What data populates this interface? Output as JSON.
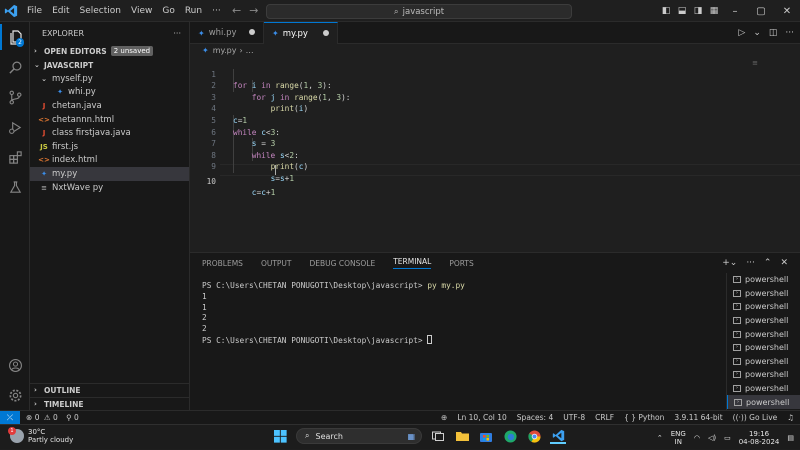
{
  "titlebar": {
    "menu": [
      "File",
      "Edit",
      "Selection",
      "View",
      "Go",
      "Run",
      "···"
    ],
    "search_text": "javascript"
  },
  "sidebar": {
    "title": "EXPLORER",
    "open_editors": "OPEN EDITORS",
    "unsaved_badge": "2 unsaved",
    "folder": "JAVASCRIPT",
    "items": [
      {
        "label": "myself.py",
        "icon": "folder-chevron",
        "indent": 1
      },
      {
        "label": "whi.py",
        "icon": "python-icon",
        "indent": 2
      },
      {
        "label": "chetan.java",
        "icon": "java-icon",
        "indent": 1
      },
      {
        "label": "chetannn.html",
        "icon": "html-icon",
        "indent": 1
      },
      {
        "label": "class firstjava.java",
        "icon": "java-icon",
        "indent": 1
      },
      {
        "label": "first.js",
        "icon": "js-icon",
        "indent": 1
      },
      {
        "label": "index.html",
        "icon": "html-icon",
        "indent": 1
      },
      {
        "label": "my.py",
        "icon": "python-icon",
        "indent": 1,
        "selected": true
      },
      {
        "label": "NxtWave py",
        "icon": "text-icon",
        "indent": 1
      }
    ],
    "outline": "OUTLINE",
    "timeline": "TIMELINE",
    "activity_badge": "2"
  },
  "editor": {
    "tabs": [
      {
        "label": "whi.py",
        "active": false,
        "dirty": true
      },
      {
        "label": "my.py",
        "active": true,
        "dirty": true
      }
    ],
    "breadcrumb": [
      "my.py",
      "…"
    ],
    "lines": [
      {
        "n": "1",
        "indent": 0
      },
      {
        "n": "2",
        "indent": 1
      },
      {
        "n": "3",
        "indent": 2
      },
      {
        "n": "4",
        "indent": 0
      },
      {
        "n": "5",
        "indent": 0
      },
      {
        "n": "6",
        "indent": 1
      },
      {
        "n": "7",
        "indent": 1
      },
      {
        "n": "8",
        "indent": 2
      },
      {
        "n": "9",
        "indent": 2
      },
      {
        "n": "10",
        "indent": 1
      }
    ],
    "current_line": "10"
  },
  "panel": {
    "tabs": [
      "PROBLEMS",
      "OUTPUT",
      "DEBUG CONSOLE",
      "TERMINAL",
      "PORTS"
    ],
    "active_tab": "TERMINAL",
    "prompt": "PS C:\\Users\\CHETAN PONUGOTI\\Desktop\\javascript>",
    "command": "py my.py",
    "output": [
      "1",
      "1",
      "2",
      "2"
    ],
    "shells": [
      "powershell",
      "powershell",
      "powershell",
      "powershell",
      "powershell",
      "powershell",
      "powershell",
      "powershell",
      "powershell",
      "powershell"
    ]
  },
  "statusbar": {
    "errors": "0",
    "warnings": "0",
    "ports": "0",
    "position": "Ln 10, Col 10",
    "spaces": "Spaces: 4",
    "encoding": "UTF-8",
    "eol": "CRLF",
    "language": "Python",
    "interpreter": "3.9.11 64-bit",
    "golive": "Go Live"
  },
  "taskbar": {
    "temp": "30°C",
    "weather": "Partly cloudy",
    "weather_badge": "1",
    "search": "Search",
    "lang_top": "ENG",
    "lang_bottom": "IN",
    "time": "19:16",
    "date": "04-08-2024"
  },
  "colors": {
    "accent": "#0078d4",
    "keyword": "#c586c0",
    "function": "#dcdcaa",
    "variable": "#9cdcfe",
    "number": "#b5cea8"
  }
}
